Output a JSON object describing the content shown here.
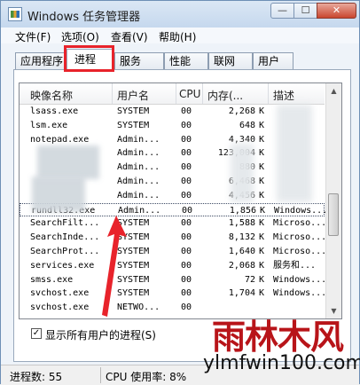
{
  "window": {
    "title": "Windows 任务管理器",
    "min_label": "—",
    "max_label": "☐",
    "close_label": "✕"
  },
  "menu": [
    "文件(F)",
    "选项(O)",
    "查看(V)",
    "帮助(H)"
  ],
  "tabs": [
    "应用程序",
    "进程",
    "服务",
    "性能",
    "联网",
    "用户"
  ],
  "active_tab": "进程",
  "columns": {
    "name": "映像名称",
    "user": "用户名",
    "cpu": "CPU",
    "mem": "内存(...",
    "desc": "描述"
  },
  "rows": [
    {
      "name": "lsass.exe",
      "user": "SYSTEM",
      "cpu": "00",
      "mem": "2,268",
      "unit": "K",
      "desc": ""
    },
    {
      "name": "lsm.exe",
      "user": "SYSTEM",
      "cpu": "00",
      "mem": "648",
      "unit": "K",
      "desc": ""
    },
    {
      "name": "notepad.exe",
      "user": "Admin...",
      "cpu": "00",
      "mem": "4,340",
      "unit": "K",
      "desc": ""
    },
    {
      "name": "",
      "user": "Admin...",
      "cpu": "00",
      "mem": "123,004",
      "unit": "K",
      "desc": ""
    },
    {
      "name": "",
      "user": "Admin...",
      "cpu": "00",
      "mem": "880",
      "unit": "K",
      "desc": ""
    },
    {
      "name": "",
      "user": "Admin...",
      "cpu": "00",
      "mem": "6,468",
      "unit": "K",
      "desc": ""
    },
    {
      "name": "",
      "user": "Admin...",
      "cpu": "00",
      "mem": "4,456",
      "unit": "K",
      "desc": ""
    },
    {
      "name": "rundll32.exe",
      "user": "Admin...",
      "cpu": "00",
      "mem": "1,856",
      "unit": "K",
      "desc": "Windows...",
      "selected": true
    },
    {
      "name": "SearchFilt...",
      "user": "SYSTEM",
      "cpu": "00",
      "mem": "1,588",
      "unit": "K",
      "desc": "Microso..."
    },
    {
      "name": "SearchInde...",
      "user": "SYSTEM",
      "cpu": "00",
      "mem": "8,132",
      "unit": "K",
      "desc": "Microso..."
    },
    {
      "name": "SearchProt...",
      "user": "SYSTEM",
      "cpu": "00",
      "mem": "1,640",
      "unit": "K",
      "desc": "Microso..."
    },
    {
      "name": "services.exe",
      "user": "SYSTEM",
      "cpu": "00",
      "mem": "2,068",
      "unit": "K",
      "desc": "服务和..."
    },
    {
      "name": "smss.exe",
      "user": "SYSTEM",
      "cpu": "00",
      "mem": "72",
      "unit": "K",
      "desc": "Windows..."
    },
    {
      "name": "svchost.exe",
      "user": "SYSTEM",
      "cpu": "00",
      "mem": "1,704",
      "unit": "K",
      "desc": "Windows..."
    },
    {
      "name": "svchost.exe",
      "user": "NETWO...",
      "cpu": "00",
      "mem": "",
      "unit": "",
      "desc": ""
    }
  ],
  "show_all_users": {
    "label": "显示所有用户的进程(S)",
    "checked": true,
    "check_glyph": "✓"
  },
  "status": {
    "processes": "进程数: 55",
    "cpu": "CPU 使用率: 8%"
  },
  "watermark": {
    "text": "雨林木风",
    "url": "ylmfwin100.com"
  },
  "colors": {
    "highlight_red": "#e8232b",
    "watermark_red": "#b81419"
  }
}
